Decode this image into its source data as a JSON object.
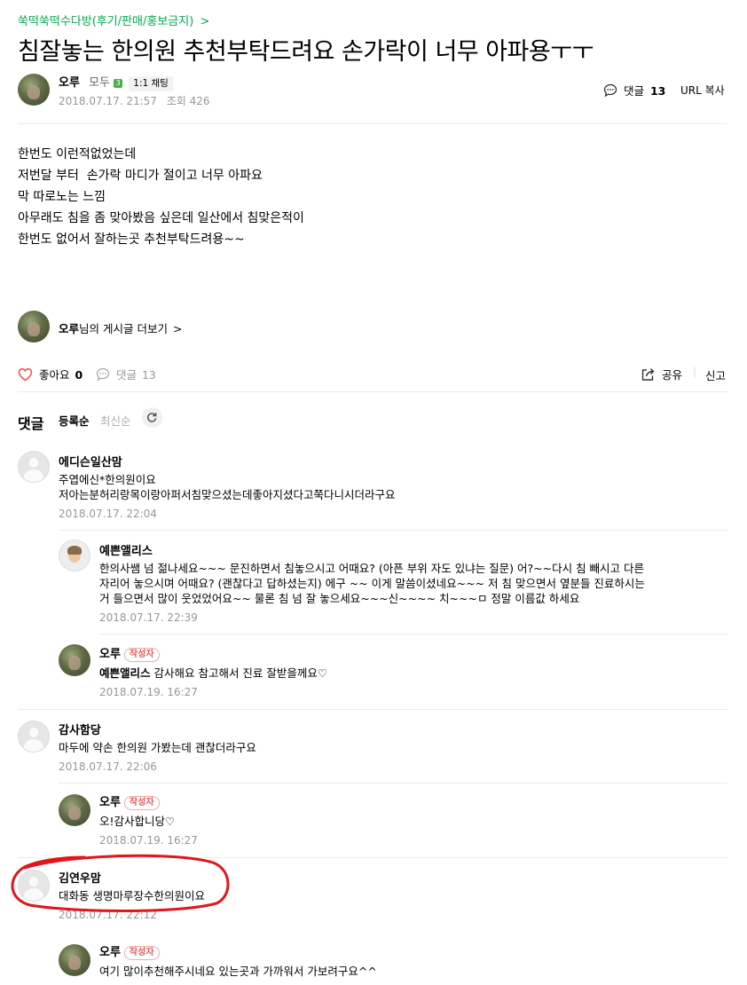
{
  "board": {
    "name": "쑥떡쑥떡수다방(후기/판매/홍보금지)",
    "chevron": ">"
  },
  "post": {
    "title": "침잘놓는 한의원 추천부탁드려요 손가락이 너무 아파용ㅜㅜ",
    "author": "오루",
    "author_group": "모두",
    "level": "3",
    "chat_label": "1:1 채팅",
    "date": "2018.07.17. 21:57",
    "views_label": "조회 426",
    "comment_label": "댓글",
    "comment_count": "13",
    "url_copy": "URL 복사",
    "body": [
      "한번도 이런적없었는데",
      "저번달 부터  손가락 마디가 절이고 너무 아파요",
      "막 따로노는 느낌",
      "아무래도 침을 좀 맞아봤음 싶은데 일산에서 침맞은적이",
      "한번도 없어서 잘하는곳 추천부탁드려용~~"
    ]
  },
  "more_posts": {
    "author": "오루",
    "suffix": "님의 게시글 더보기",
    "chevron": ">"
  },
  "actions": {
    "like_label": "좋아요",
    "like_count": "0",
    "comment_label": "댓글",
    "comment_count": "13",
    "share_label": "공유",
    "sep": "|",
    "report_label": "신고"
  },
  "comments_header": {
    "title": "댓글",
    "sort_register": "등록순",
    "sort_recent": "최신순"
  },
  "comments": [
    {
      "name": "에디슨일산맘",
      "text": "주엽에신*한의원이요\n저아는분허리랑목이랑아퍼서침맞으셨는데좋아지셨다고쭉다니시더라구요",
      "date": "2018.07.17. 22:04"
    },
    {
      "name": "예쁜앨리스",
      "text": "한의사쌤 넘 젊나세요~~~ 문진하면서 침놓으시고 어때요? (아픈 부위 자도 있냐는 질문) 어?~~다시 침 빼시고 다른\n자리어 놓으시며 어때요? (괜찮다고 답하셨는지) 에구 ~~ 이게 말씀이셨네요~~~ 저 침 맞으면서 옆분들 진료하시는\n거 들으면서 많이 웃었었어요~~ 물론 침 넘 잘 놓으세요~~~신~~~~ 치~~~ㅁ 정말 이름값 하세요",
      "date": "2018.07.17. 22:39"
    },
    {
      "name": "오루",
      "badge": "작성자",
      "mention": "예쁜앨리스",
      "text": " 감사해요 참고해서 진료 잘받을께요♡",
      "date": "2018.07.19. 16:27"
    },
    {
      "name": "감사함당",
      "text": "마두에 약손 한의원 가봤는데 괜찮더라구요",
      "date": "2018.07.17. 22:06"
    },
    {
      "name": "오루",
      "badge": "작성자",
      "text": "오!감사합니당♡",
      "date": "2018.07.19. 16:27"
    },
    {
      "name": "김연우맘",
      "text": "대화동 생명마루장수한의원이요",
      "date": "2018.07.17. 22:12"
    },
    {
      "name": "오루",
      "badge": "작성자",
      "text": "여기 많이추천해주시네요 있는곳과 가까워서 가보려구요^^"
    }
  ],
  "colors": {
    "board_green": "#03c75a",
    "level_green": "#48b04a",
    "highlight_red": "#e0161b",
    "like_red": "#f04b4b"
  }
}
